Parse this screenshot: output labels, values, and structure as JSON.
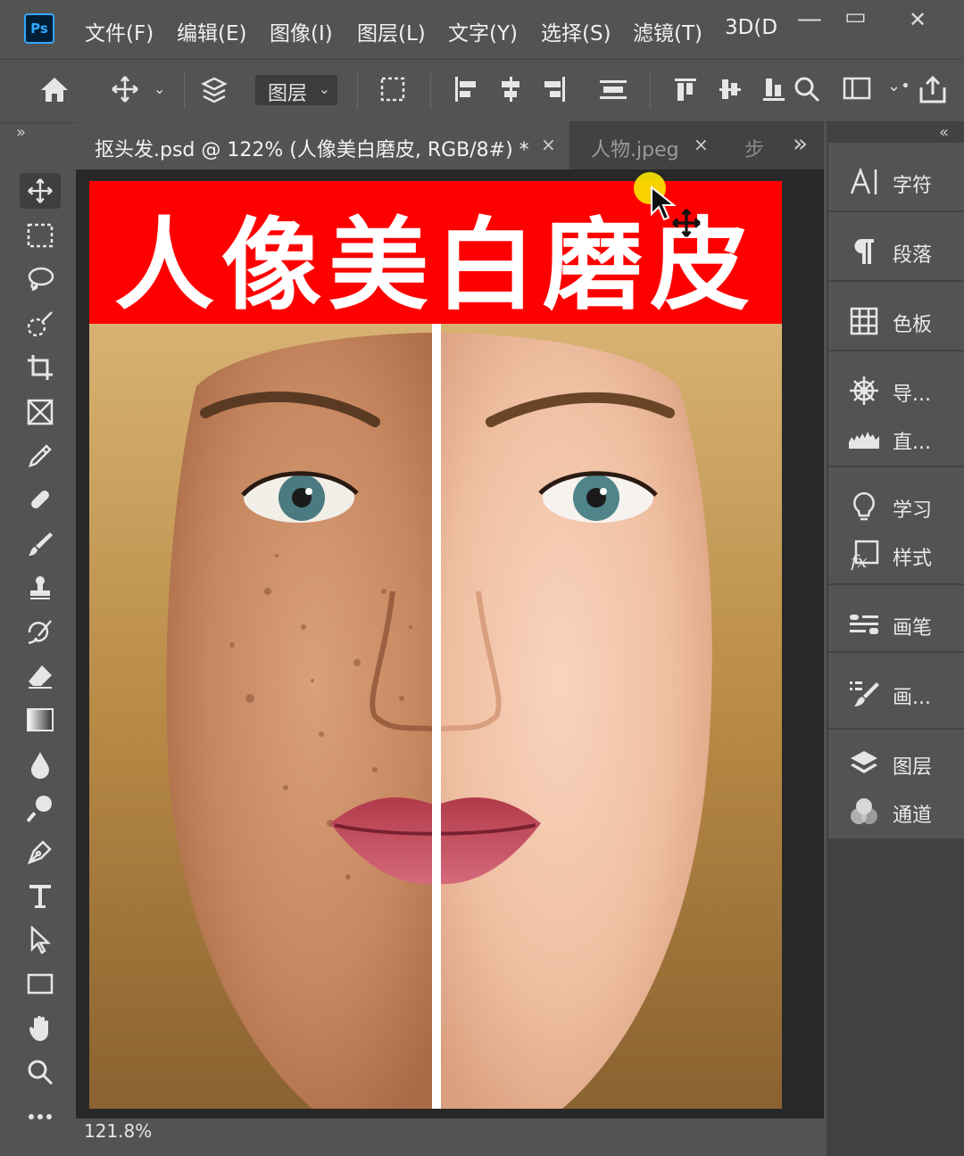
{
  "app": {
    "logo": "Ps"
  },
  "menubar": {
    "items": [
      "文件(F)",
      "编辑(E)",
      "图像(I)",
      "图层(L)",
      "文字(Y)",
      "选择(S)",
      "滤镜(T)",
      "3D(D"
    ],
    "minimize": "—",
    "restore": "▭",
    "close": "✕"
  },
  "options": {
    "layer_select": "图层",
    "dropdown_arrow": "⌄"
  },
  "tabs": [
    {
      "label": "抠头发.psd @ 122% (人像美白磨皮, RGB/8#) *",
      "close": "×",
      "active": true
    },
    {
      "label": "人物.jpeg",
      "close": "×",
      "active": false
    },
    {
      "label": "步",
      "active": false
    }
  ],
  "tabs_overflow": "»",
  "panel_collapse_left": "»",
  "panel_collapse_right": "«",
  "document": {
    "banner_title": "人像美白磨皮",
    "banner_color": "#ff0000"
  },
  "status": {
    "zoom": "121.8%"
  },
  "right_panels": [
    {
      "label": "字符",
      "icon": "character-icon"
    },
    {
      "label": "段落",
      "icon": "paragraph-icon"
    },
    {
      "label": "色板",
      "icon": "swatches-icon"
    },
    {
      "label": "导...",
      "icon": "navigator-icon"
    },
    {
      "label": "直...",
      "icon": "histogram-icon"
    },
    {
      "label": "学习",
      "icon": "learn-icon"
    },
    {
      "label": "样式",
      "icon": "styles-icon"
    },
    {
      "label": "画笔",
      "icon": "brushes-icon"
    },
    {
      "label": "画...",
      "icon": "brush-settings-icon"
    },
    {
      "label": "图层",
      "icon": "layers-icon"
    },
    {
      "label": "通道",
      "icon": "channels-icon"
    }
  ],
  "tools": [
    "move-tool-icon",
    "marquee-tool-icon",
    "lasso-tool-icon",
    "quick-select-tool-icon",
    "crop-tool-icon",
    "frame-tool-icon",
    "eyedropper-tool-icon",
    "healing-brush-tool-icon",
    "brush-tool-icon",
    "clone-stamp-tool-icon",
    "history-brush-tool-icon",
    "eraser-tool-icon",
    "gradient-tool-icon",
    "blur-tool-icon",
    "dodge-tool-icon",
    "pen-tool-icon",
    "type-tool-icon",
    "path-select-tool-icon",
    "rectangle-tool-icon",
    "hand-tool-icon",
    "zoom-tool-icon",
    "more-tools-icon"
  ]
}
